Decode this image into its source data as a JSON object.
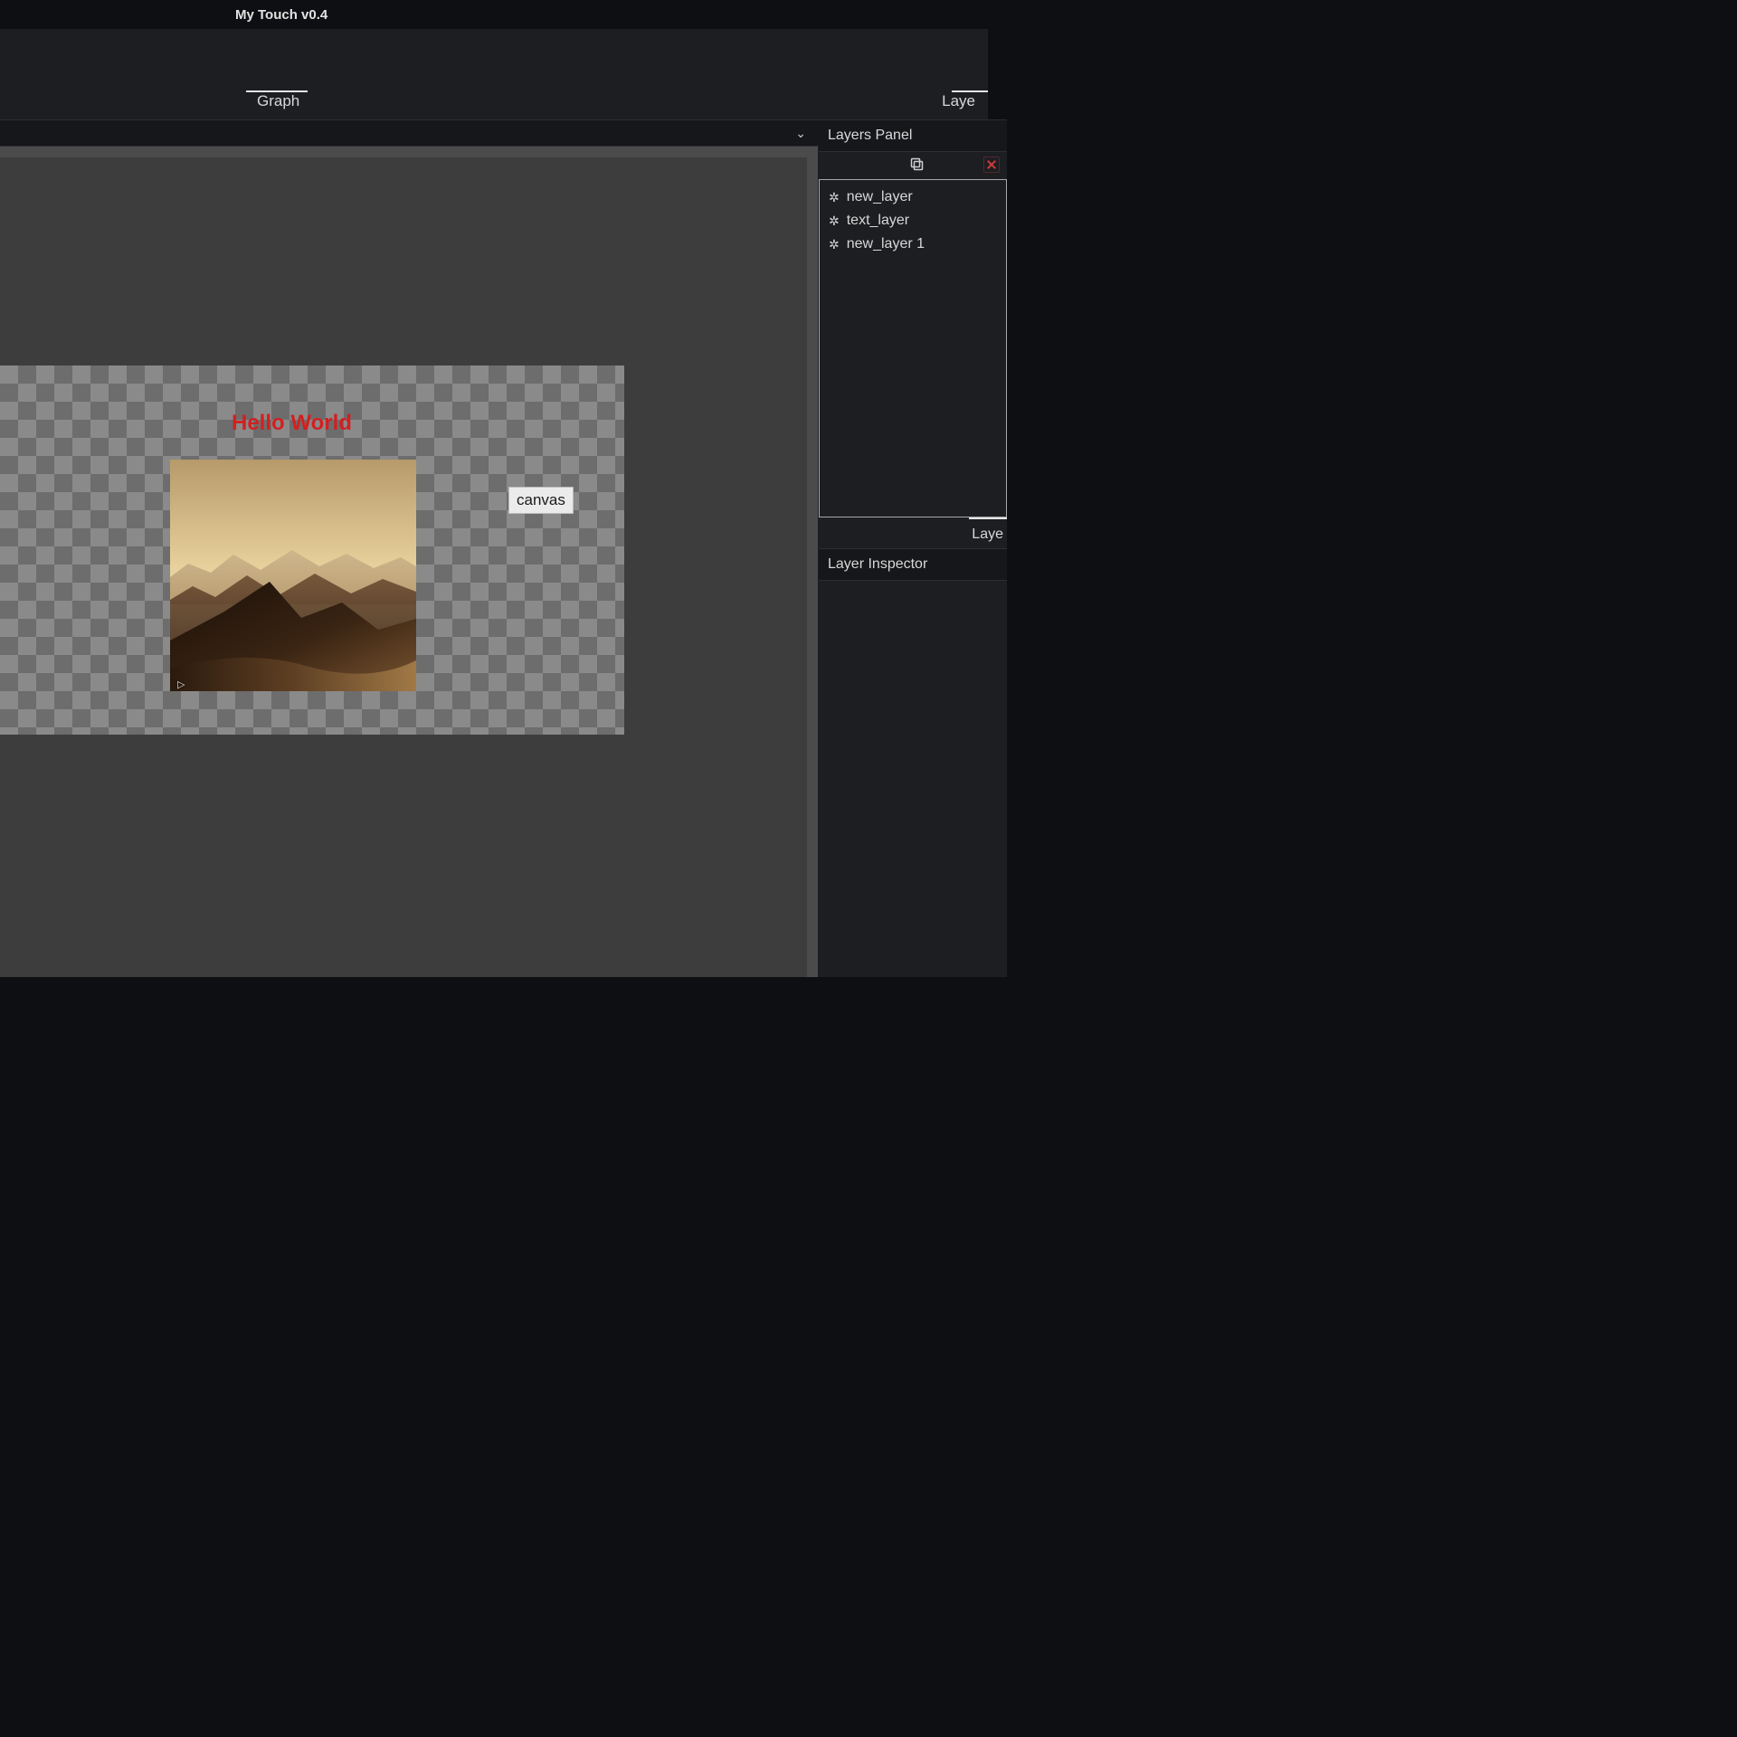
{
  "titlebar": {
    "title": "My Touch v0.4"
  },
  "tabs": {
    "left_label": "Graph",
    "right_label": "Laye"
  },
  "canvas": {
    "overlay_text": "Hello World",
    "tooltip": "canvas",
    "cursor_glyph": "▷"
  },
  "right_panel": {
    "layers_title": "Layers Panel",
    "layers": [
      {
        "name": "new_layer"
      },
      {
        "name": "text_layer"
      },
      {
        "name": "new_layer 1"
      }
    ],
    "subtab_label": "Laye",
    "inspector_title": "Layer Inspector"
  },
  "icons": {
    "gear": "✲",
    "chevron_down": "⌄"
  }
}
